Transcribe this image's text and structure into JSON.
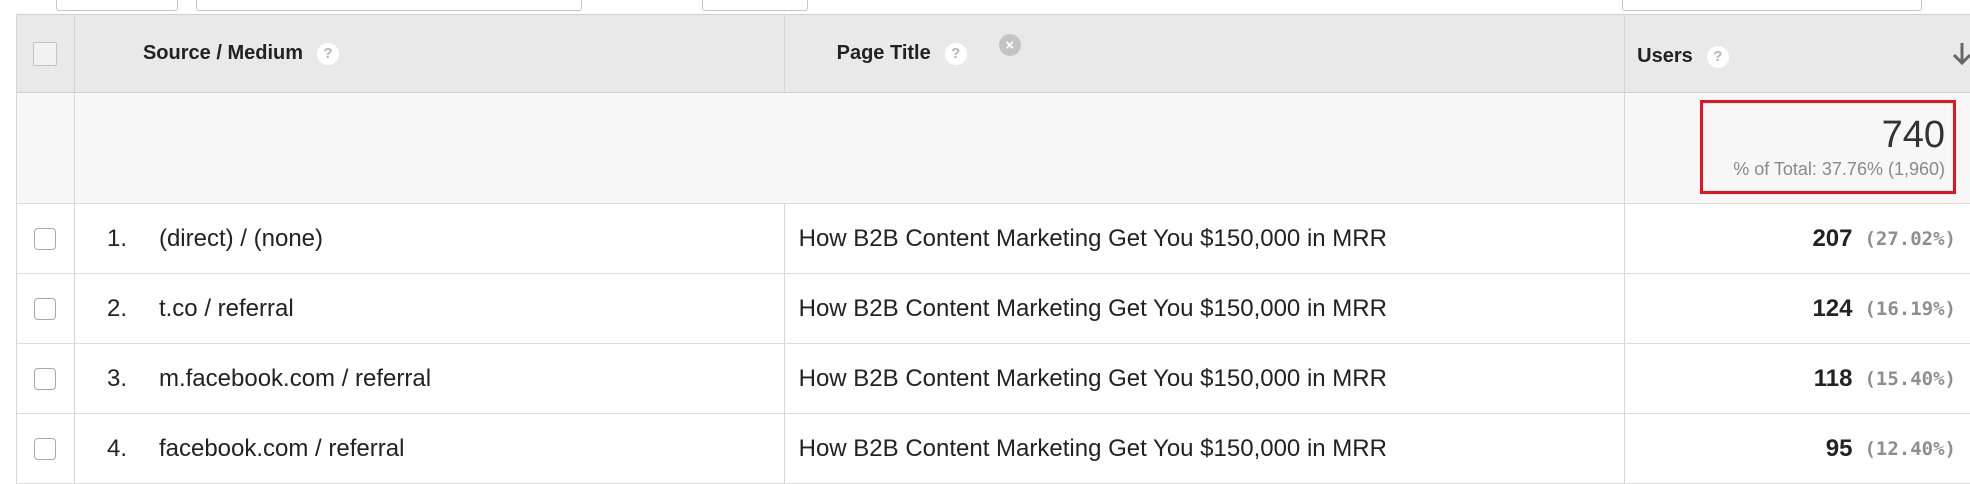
{
  "table": {
    "columns": {
      "source_medium": "Source / Medium",
      "page_title": "Page Title",
      "users": "Users"
    },
    "icons": {
      "help": "?",
      "remove": "×"
    },
    "total": {
      "value": "740",
      "subtext": "% of Total: 37.76% (1,960)"
    },
    "rows": [
      {
        "rank": "1.",
        "source": "(direct) / (none)",
        "title": "How B2B Content Marketing Get You $150,000 in MRR",
        "users": "207",
        "pct": "(27.02%)"
      },
      {
        "rank": "2.",
        "source": "t.co / referral",
        "title": "How B2B Content Marketing Get You $150,000 in MRR",
        "users": "124",
        "pct": "(16.19%)"
      },
      {
        "rank": "3.",
        "source": "m.facebook.com / referral",
        "title": "How B2B Content Marketing Get You $150,000 in MRR",
        "users": "118",
        "pct": "(15.40%)"
      },
      {
        "rank": "4.",
        "source": "facebook.com / referral",
        "title": "How B2B Content Marketing Get You $150,000 in MRR",
        "users": "95",
        "pct": "(12.40%)"
      }
    ],
    "highlight_color": "#e3141f"
  }
}
